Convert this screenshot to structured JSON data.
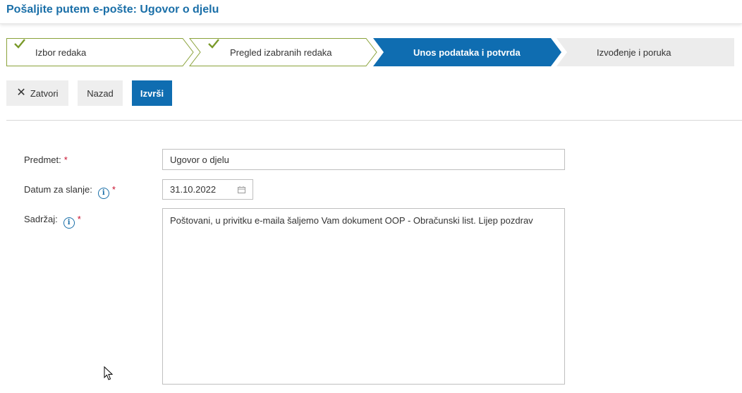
{
  "header": {
    "title": "Pošaljite putem e-pošte: Ugovor o djelu"
  },
  "wizard": {
    "steps": [
      {
        "label": "Izbor redaka",
        "state": "done"
      },
      {
        "label": "Pregled izabranih redaka",
        "state": "done"
      },
      {
        "label": "Unos podataka i potvrda",
        "state": "active"
      },
      {
        "label": "Izvođenje i poruka",
        "state": "pending"
      }
    ]
  },
  "toolbar": {
    "close_label": "Zatvori",
    "back_label": "Nazad",
    "run_label": "Izvrši"
  },
  "form": {
    "subject": {
      "label": "Predmet:",
      "value": "Ugovor o djelu"
    },
    "date": {
      "label": "Datum za slanje:",
      "value": "31.10.2022"
    },
    "content": {
      "label": "Sadržaj:",
      "value": "Poštovani, u privitku e-maila šaljemo Vam dokument OOP - Obračunski list. Lijep pozdrav"
    },
    "required_mark": "*",
    "info_glyph": "i"
  },
  "colors": {
    "accent": "#0f6db1",
    "title": "#1a6fa8",
    "done_check": "#7a9a2a",
    "required": "#c8102e"
  }
}
